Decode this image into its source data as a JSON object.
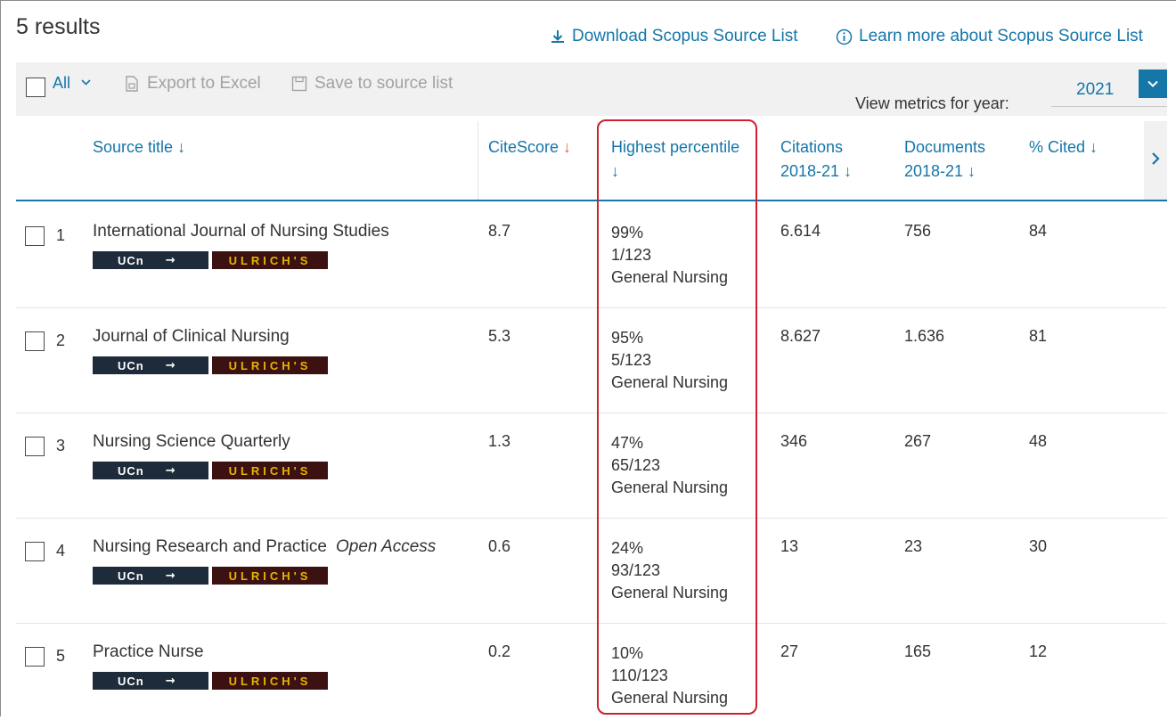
{
  "header": {
    "results_label": "5 results",
    "download_label": "Download Scopus Source List",
    "learn_more_label": "Learn more about Scopus Source List"
  },
  "toolbar": {
    "select_all_label": "All",
    "export_label": "Export to Excel",
    "save_label": "Save to source list",
    "metrics_year_label": "View metrics for year:",
    "metrics_year_value": "2021"
  },
  "columns": {
    "source_title": "Source title",
    "citescore": "CiteScore",
    "highest_percentile": "Highest percentile",
    "citations_line1": "Citations",
    "citations_line2": "2018-21",
    "documents_line1": "Documents",
    "documents_line2": "2018-21",
    "percent_cited": "% Cited"
  },
  "badges": {
    "ucn": "UCn",
    "ulrich": "ULRICH'S"
  },
  "rows": [
    {
      "num": "1",
      "title": "International Journal of Nursing Studies",
      "open_access": "",
      "citescore": "8.7",
      "percentile": "99%",
      "rank": "1/123",
      "category": "General Nursing",
      "citations": "6.614",
      "documents": "756",
      "cited": "84"
    },
    {
      "num": "2",
      "title": "Journal of Clinical Nursing",
      "open_access": "",
      "citescore": "5.3",
      "percentile": "95%",
      "rank": "5/123",
      "category": "General Nursing",
      "citations": "8.627",
      "documents": "1.636",
      "cited": "81"
    },
    {
      "num": "3",
      "title": "Nursing Science Quarterly",
      "open_access": "",
      "citescore": "1.3",
      "percentile": "47%",
      "rank": "65/123",
      "category": "General Nursing",
      "citations": "346",
      "documents": "267",
      "cited": "48"
    },
    {
      "num": "4",
      "title": "Nursing Research and Practice",
      "open_access": "Open Access",
      "citescore": "0.6",
      "percentile": "24%",
      "rank": "93/123",
      "category": "General Nursing",
      "citations": "13",
      "documents": "23",
      "cited": "30"
    },
    {
      "num": "5",
      "title": "Practice Nurse",
      "open_access": "",
      "citescore": "0.2",
      "percentile": "10%",
      "rank": "110/123",
      "category": "General Nursing",
      "citations": "27",
      "documents": "165",
      "cited": "12"
    }
  ],
  "colors": {
    "link": "#1576a8",
    "highlight": "#cf1f2e",
    "citescore_sort_arrow": "#e8643a"
  },
  "icons": {
    "sort": "arrow-down-icon",
    "download": "download-icon",
    "info": "info-circle-icon",
    "export": "excel-file-icon",
    "save": "save-icon",
    "dropdown": "chevron-down-icon",
    "scroll": "chevron-right-icon"
  }
}
